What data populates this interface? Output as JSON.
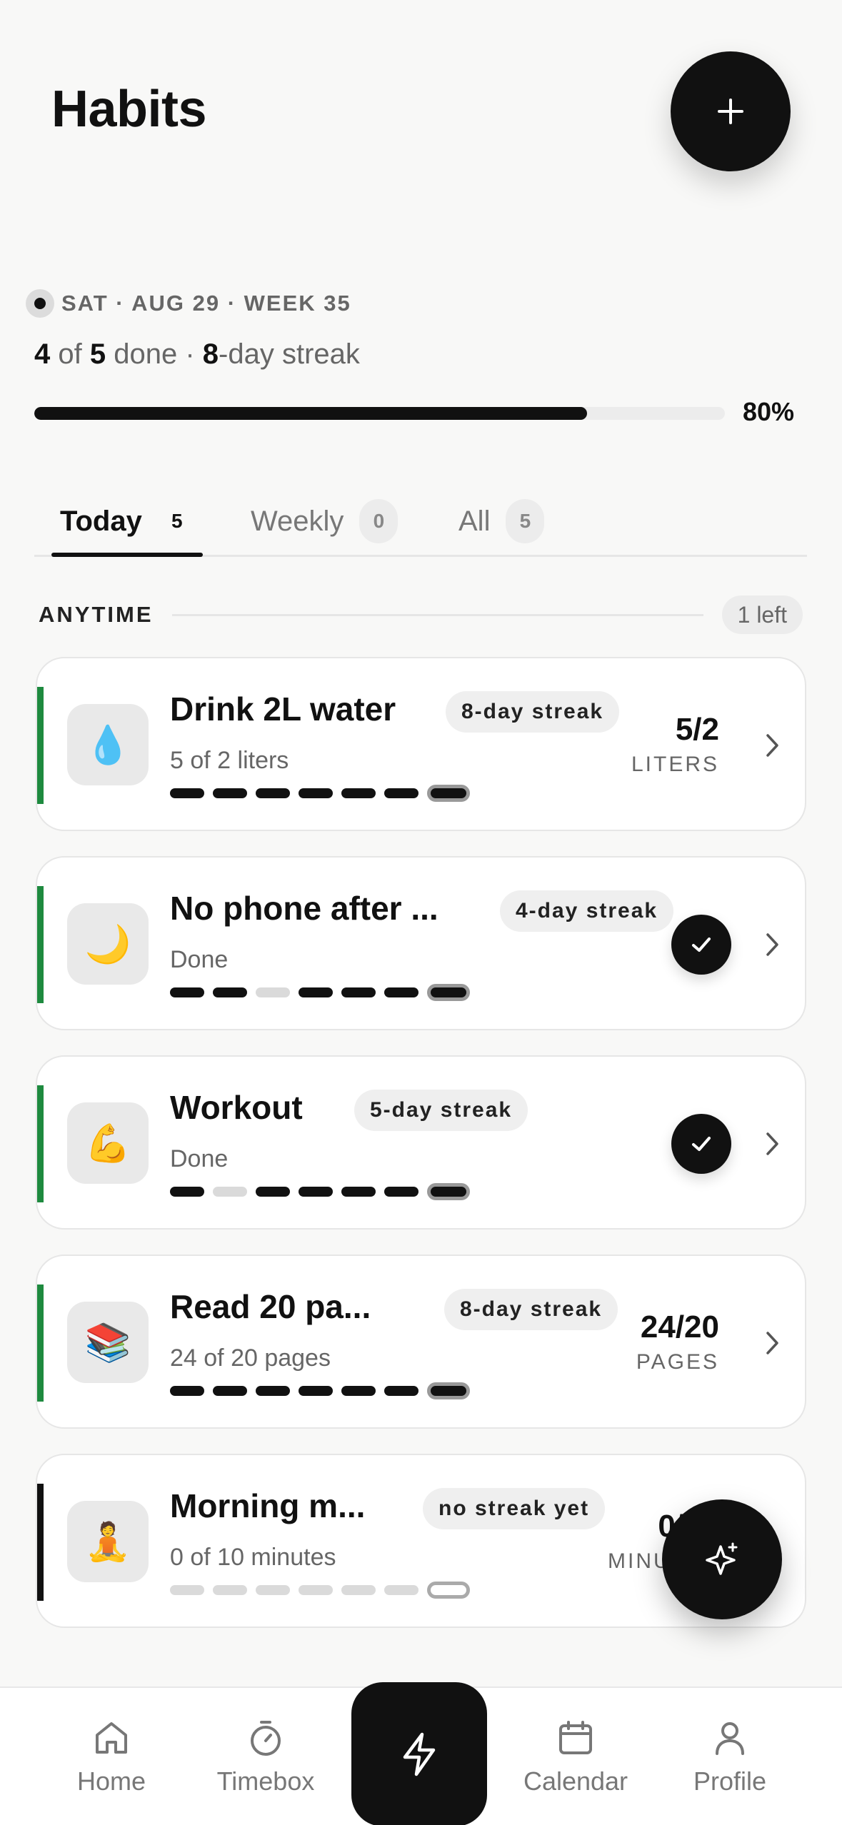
{
  "header": {
    "title": "Habits",
    "add_icon": "plus-icon"
  },
  "status": {
    "date": "SAT · AUG 29 · WEEK 35",
    "done": "4",
    "of_word": "of",
    "total": "5",
    "done_word": "done ·",
    "streak_num": "8",
    "streak_word": "-day streak",
    "progress_fraction": 0.8,
    "progress_label": "80%"
  },
  "tabs": [
    {
      "label": "Today",
      "count": "5",
      "active": true
    },
    {
      "label": "Weekly",
      "count": "0",
      "active": false
    },
    {
      "label": "All",
      "count": "5",
      "active": false
    }
  ],
  "section": {
    "label": "ANYTIME",
    "badge": "1 left"
  },
  "habits": [
    {
      "icon": "💧",
      "icon_name": "water-drop-icon",
      "name": "Drink 2L water",
      "streak": "8-day streak",
      "sub": "5 of 2 liters",
      "value": "5/2",
      "unit": "LITERS",
      "done": false,
      "history": [
        1,
        1,
        1,
        1,
        1,
        1
      ],
      "today": "filled",
      "accent": "#1e8a3f"
    },
    {
      "icon": "🌙",
      "icon_name": "moon-icon",
      "name": "No phone after ...",
      "streak": "4-day streak",
      "sub": "Done",
      "value": "",
      "unit": "",
      "done": true,
      "history": [
        1,
        1,
        0,
        1,
        1,
        1
      ],
      "today": "filled",
      "accent": "#1e8a3f"
    },
    {
      "icon": "💪",
      "icon_name": "flexed-bicep-icon",
      "name": "Workout",
      "streak": "5-day streak",
      "sub": "Done",
      "value": "",
      "unit": "",
      "done": true,
      "history": [
        1,
        0,
        1,
        1,
        1,
        1
      ],
      "today": "filled",
      "accent": "#1e8a3f"
    },
    {
      "icon": "📚",
      "icon_name": "books-icon",
      "name": "Read 20 pa...",
      "streak": "8-day streak",
      "sub": "24 of 20 pages",
      "value": "24/20",
      "unit": "PAGES",
      "done": false,
      "history": [
        1,
        1,
        1,
        1,
        1,
        1
      ],
      "today": "filled",
      "accent": "#1e8a3f"
    },
    {
      "icon": "🧘",
      "icon_name": "meditation-icon",
      "name": "Morning m...",
      "streak": "no streak yet",
      "sub": "0 of 10 minutes",
      "value": "0/10",
      "unit": "MINUTES",
      "done": false,
      "history": [
        0,
        0,
        0,
        0,
        0,
        0
      ],
      "today": "empty",
      "accent": "#111111"
    }
  ],
  "fab": {
    "icon": "sparkle-icon"
  },
  "nav": [
    {
      "label": "Home",
      "icon": "home-icon"
    },
    {
      "label": "Timebox",
      "icon": "stopwatch-icon"
    },
    {
      "label": "",
      "icon": "lightning-icon"
    },
    {
      "label": "Calendar",
      "icon": "calendar-icon"
    },
    {
      "label": "Profile",
      "icon": "profile-icon"
    }
  ]
}
